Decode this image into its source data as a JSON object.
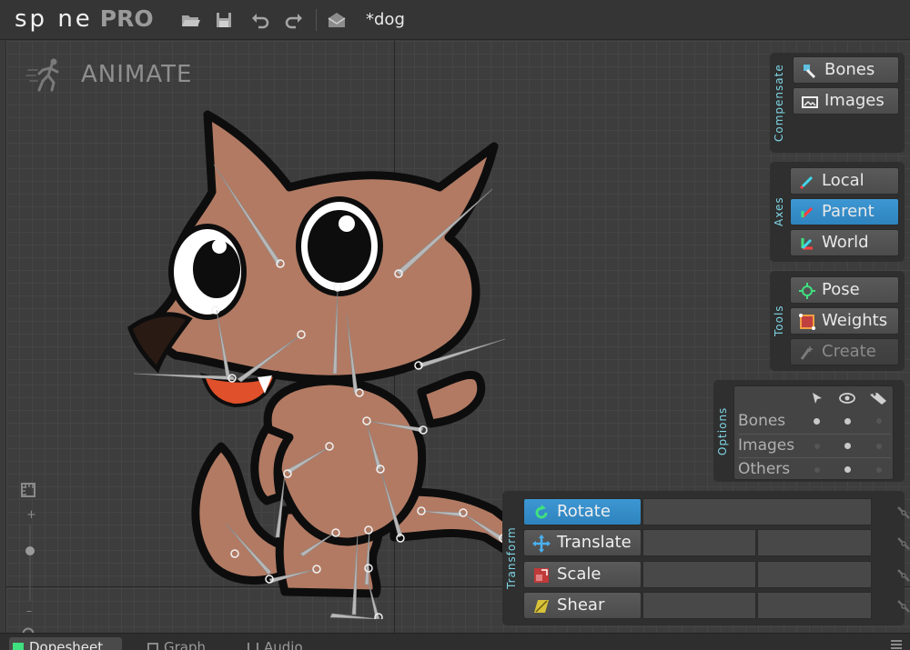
{
  "app": {
    "logo_text": "sp ne",
    "logo_pro": "PRO",
    "document_title": "*dog"
  },
  "toolbar": {
    "icons": [
      "folder-open-icon",
      "save-icon",
      "undo-icon",
      "redo-icon",
      "envelope-icon"
    ]
  },
  "viewport": {
    "mode_label": "ANIMATE",
    "mode_icon": "running-figure-icon"
  },
  "compensate": {
    "title": "Compensate",
    "buttons": [
      "Bones",
      "Images"
    ]
  },
  "axes": {
    "title": "Axes",
    "buttons": [
      "Local",
      "Parent",
      "World"
    ],
    "active": "Parent"
  },
  "tools": {
    "title": "Tools",
    "buttons": [
      "Pose",
      "Weights",
      "Create"
    ],
    "disabled": "Create"
  },
  "options": {
    "title": "Options",
    "columns": [
      "select-arrow-icon",
      "eye-icon",
      "tag-icon"
    ],
    "rows": [
      {
        "label": "Bones",
        "states": [
          true,
          true,
          false
        ]
      },
      {
        "label": "Images",
        "states": [
          false,
          true,
          false
        ]
      },
      {
        "label": "Others",
        "states": [
          false,
          true,
          false
        ]
      }
    ]
  },
  "transform": {
    "title": "Transform",
    "buttons": [
      "Rotate",
      "Translate",
      "Scale",
      "Shear"
    ],
    "active": "Rotate"
  },
  "bottom_tabs": [
    "Dopesheet",
    "Graph",
    "Audio"
  ],
  "zoom": {
    "plus": "+",
    "minus": "–"
  },
  "colors": {
    "accent": "#3a92cf",
    "panel": "#2f2f2f",
    "dog_fur": "#b27a63",
    "section_title": "#7fd6e6"
  }
}
